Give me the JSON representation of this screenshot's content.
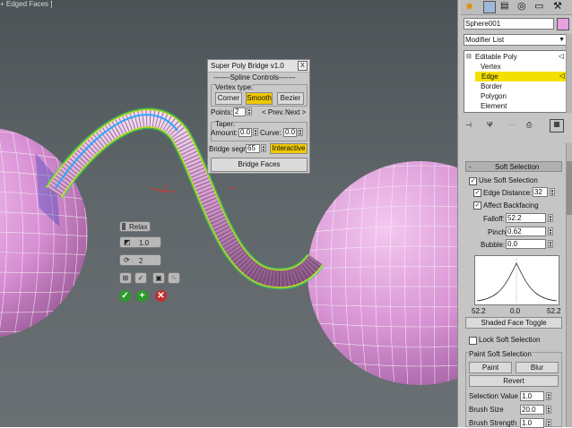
{
  "viewport": {
    "label": "+ Edged Faces ]"
  },
  "dialog": {
    "title": "Super Poly Bridge v1.0",
    "close_label": "X",
    "section_title": "-------Spline Controls-------",
    "vertex_type_label": "Vertex type:",
    "vertex_types": [
      "Corner",
      "Smooth",
      "Bezier"
    ],
    "vertex_type_selected": "Smooth",
    "points_label": "Points:",
    "points_value": "2",
    "prev_label": "< Prev.",
    "next_label": "Next >",
    "taper_label": "Taper:",
    "amount_label": "Amount:",
    "amount_value": "0.0",
    "curve_label": "Curve:",
    "curve_value": "0.0",
    "bridge_segs_label": "Bridge segm",
    "bridge_segs_value": "65",
    "interactive_label": "Interactive",
    "bridge_faces_label": "Bridge Faces"
  },
  "caddy": {
    "title": "Relax",
    "amount_value": "1.0",
    "iterations_value": "2"
  },
  "panel": {
    "object_name": "Sphere001",
    "object_color": "#e8a0e0",
    "modifier_list_label": "Modifier List",
    "stack": {
      "root": "Editable Poly",
      "items": [
        "Vertex",
        "Edge",
        "Border",
        "Polygon",
        "Element"
      ],
      "selected": "Edge"
    },
    "soft_selection": {
      "title": "Soft Selection",
      "use_soft_selection": "Use Soft Selection",
      "edge_distance_label": "Edge Distance:",
      "edge_distance_value": "32",
      "affect_backfacing": "Affect Backfacing",
      "falloff_label": "Falloff:",
      "falloff_value": "52.2",
      "pinch_label": "Pinch:",
      "pinch_value": "0.62",
      "bubble_label": "Bubble:",
      "bubble_value": "0.0",
      "graph_left": "52.2",
      "graph_mid": "0.0",
      "graph_right": "52.2",
      "shaded_face_toggle": "Shaded Face Toggle",
      "lock_soft_selection": "Lock Soft Selection"
    },
    "paint": {
      "title": "Paint Soft Selection",
      "paint_label": "Paint",
      "blur_label": "Blur",
      "revert_label": "Revert",
      "selection_value_label": "Selection Value",
      "selection_value": "1.0",
      "brush_size_label": "Brush Size",
      "brush_size_value": "20.0",
      "brush_strength_label": "Brush Strength",
      "brush_strength_value": "1.0"
    },
    "highlight_color": "#f4e000"
  }
}
